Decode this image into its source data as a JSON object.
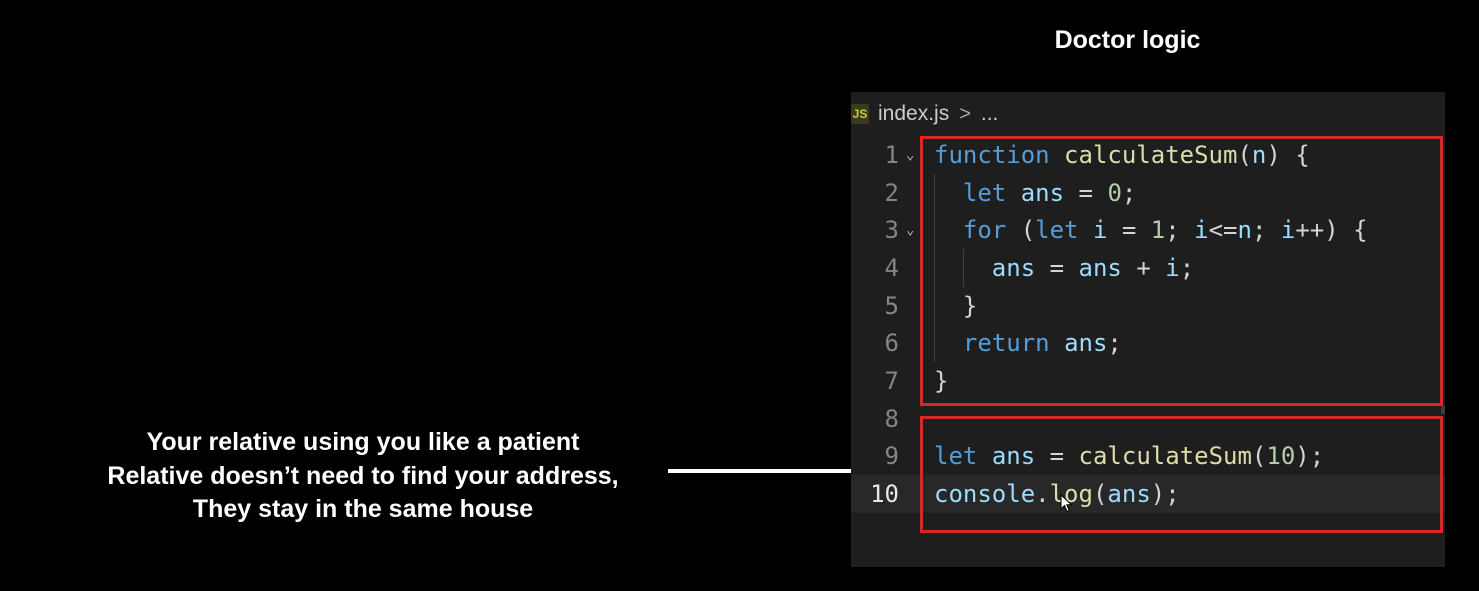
{
  "slide": {
    "title": "Doctor logic",
    "caption": [
      "Your relative using you like a patient",
      "Relative doesn’t need to find your address,",
      "They stay in the same house"
    ]
  },
  "editor": {
    "breadcrumb": {
      "icon": "js-file-icon",
      "icon_label": "JS",
      "file": "index.js",
      "separator": ">",
      "ellipsis": "..."
    },
    "lines": [
      {
        "number": "1",
        "text": "function calculateSum(n) {",
        "foldable": true
      },
      {
        "number": "2",
        "text": "  let ans = 0;",
        "foldable": false
      },
      {
        "number": "3",
        "text": "  for (let i = 1; i<=n; i++) {",
        "foldable": true
      },
      {
        "number": "4",
        "text": "    ans = ans + i;",
        "foldable": false
      },
      {
        "number": "5",
        "text": "  }",
        "foldable": false
      },
      {
        "number": "6",
        "text": "  return ans;",
        "foldable": false
      },
      {
        "number": "7",
        "text": "}",
        "foldable": false
      },
      {
        "number": "8",
        "text": "",
        "foldable": false
      },
      {
        "number": "9",
        "text": "let ans = calculateSum(10);",
        "foldable": false
      },
      {
        "number": "10",
        "text": "console.log(ans);",
        "foldable": false
      }
    ],
    "active_line": "10",
    "highlight_color": "#d42a23"
  }
}
